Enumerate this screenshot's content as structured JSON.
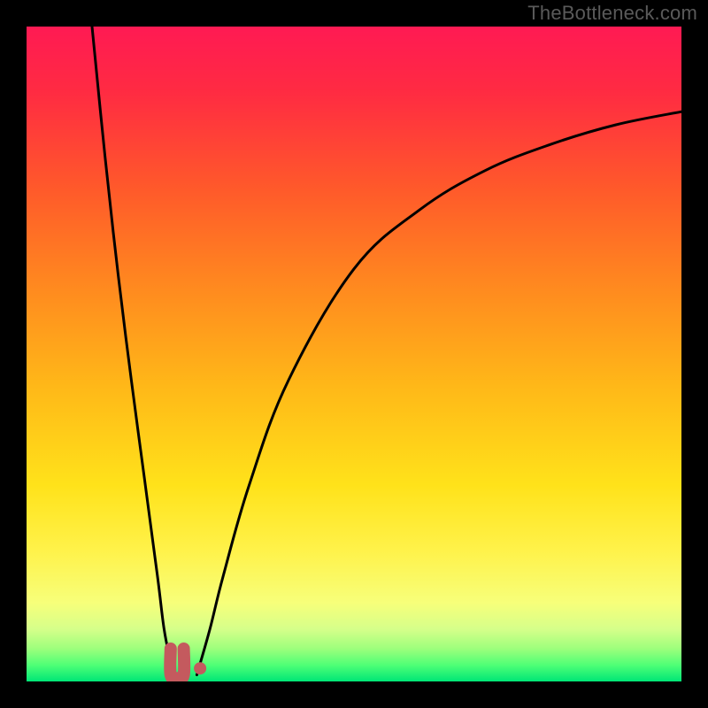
{
  "watermark": "TheBottleneck.com",
  "chart_data": {
    "type": "line",
    "title": "",
    "xlabel": "",
    "ylabel": "",
    "xlim": [
      0,
      100
    ],
    "ylim": [
      0,
      100
    ],
    "grid": false,
    "legend": false,
    "series": [
      {
        "name": "left-falling-curve",
        "x": [
          10,
          12,
          14,
          16,
          18,
          20,
          21,
          22,
          22.5
        ],
        "y": [
          100,
          80,
          62,
          46,
          31,
          16,
          8,
          3,
          1
        ]
      },
      {
        "name": "right-rising-curve",
        "x": [
          26,
          28,
          30,
          34,
          40,
          50,
          60,
          70,
          80,
          90,
          100
        ],
        "y": [
          1,
          8,
          16,
          30,
          46,
          63,
          72,
          78,
          82,
          85,
          87
        ]
      },
      {
        "name": "u-marker",
        "x": [
          22,
          22,
          23,
          24,
          24
        ],
        "y": [
          5,
          1,
          0.5,
          1,
          5
        ]
      },
      {
        "name": "dot-marker",
        "x": [
          26.5
        ],
        "y": [
          2
        ]
      }
    ],
    "background_gradient": {
      "type": "vertical",
      "stops": [
        {
          "offset": 0.0,
          "color": "#ff1a53"
        },
        {
          "offset": 0.1,
          "color": "#ff2b42"
        },
        {
          "offset": 0.25,
          "color": "#ff5a2a"
        },
        {
          "offset": 0.4,
          "color": "#ff8a1f"
        },
        {
          "offset": 0.55,
          "color": "#ffb818"
        },
        {
          "offset": 0.7,
          "color": "#ffe21a"
        },
        {
          "offset": 0.8,
          "color": "#fff24a"
        },
        {
          "offset": 0.88,
          "color": "#f7ff7a"
        },
        {
          "offset": 0.92,
          "color": "#d6ff8a"
        },
        {
          "offset": 0.95,
          "color": "#9dff7c"
        },
        {
          "offset": 0.975,
          "color": "#4fff76"
        },
        {
          "offset": 1.0,
          "color": "#00e676"
        }
      ]
    },
    "curve_color": "#000000",
    "marker_color": "#c45a5e"
  }
}
